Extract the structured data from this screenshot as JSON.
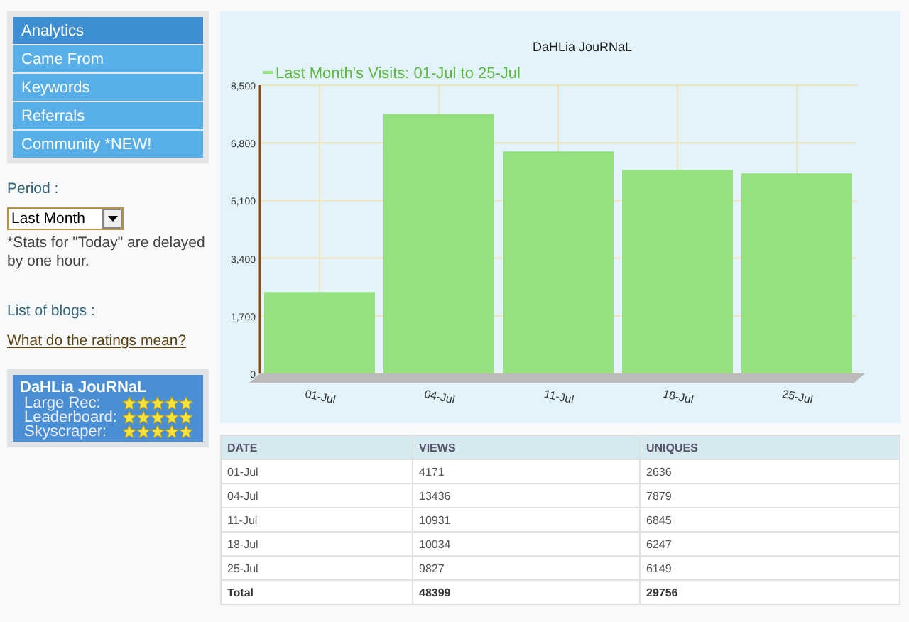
{
  "sidebar": {
    "nav": [
      {
        "label": "Analytics",
        "selected": true
      },
      {
        "label": "Came From",
        "selected": false
      },
      {
        "label": "Keywords",
        "selected": false
      },
      {
        "label": "Referrals",
        "selected": false
      },
      {
        "label": "Community *NEW!",
        "selected": false
      }
    ],
    "period_label": "Period :",
    "period": {
      "value": "Last Month"
    },
    "note": "*Stats for \"Today\" are delayed by one hour.",
    "blogs_label": "List of blogs :",
    "ratings_link": "What do the ratings mean?",
    "ratings": {
      "title": "DaHLia JouRNaL",
      "rows": [
        {
          "label": "Large Rec:",
          "stars": 5
        },
        {
          "label": "Leaderboard:",
          "stars": 5
        },
        {
          "label": "Skyscraper:",
          "stars": 5
        }
      ]
    }
  },
  "chart": {
    "chart_data": {
      "type": "bar",
      "title": "DaHLia JouRNaL",
      "categories": [
        "01-Jul",
        "04-Jul",
        "11-Jul",
        "18-Jul",
        "25-Jul"
      ],
      "series": [
        {
          "name": "Last Month's Visits: 01-Jul to 25-Jul",
          "color": "#97e07e",
          "values": [
            2400,
            7650,
            6550,
            6000,
            5900
          ]
        }
      ],
      "ylim": [
        0,
        8500
      ],
      "grid": true,
      "yticks": [
        {
          "value": 0,
          "label": "0"
        },
        {
          "value": 1700,
          "label": "1,700"
        },
        {
          "value": 3400,
          "label": "3,400"
        },
        {
          "value": 5100,
          "label": "5,100"
        },
        {
          "value": 6800,
          "label": "6,800"
        },
        {
          "value": 8500,
          "label": "8,500"
        }
      ]
    }
  },
  "table": {
    "columns": [
      "DATE",
      "VIEWS",
      "UNIQUES"
    ],
    "rows": [
      [
        "01-Jul",
        "4171",
        "2636"
      ],
      [
        "04-Jul",
        "13436",
        "7879"
      ],
      [
        "11-Jul",
        "10931",
        "6845"
      ],
      [
        "18-Jul",
        "10034",
        "6247"
      ],
      [
        "25-Jul",
        "9827",
        "6149"
      ]
    ],
    "total": [
      "Total",
      "48399",
      "29756"
    ]
  }
}
